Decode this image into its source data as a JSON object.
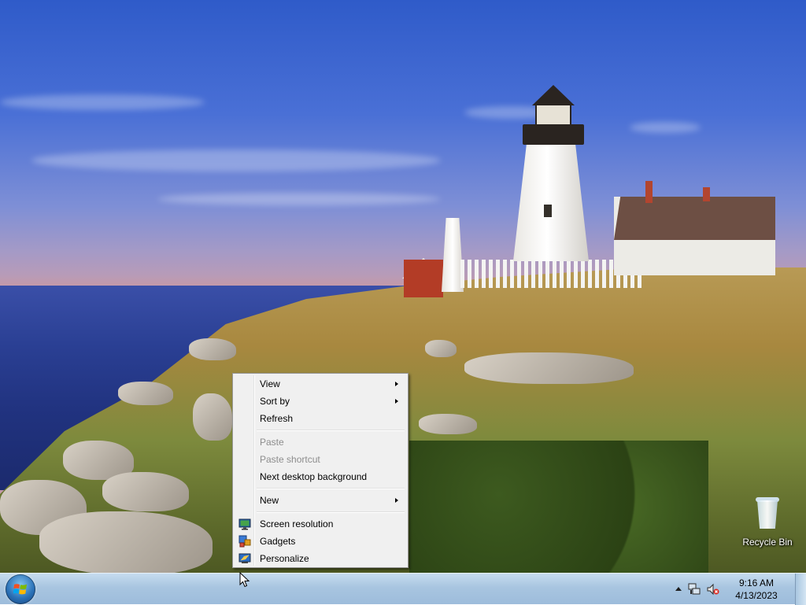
{
  "desktop": {
    "icons": [
      {
        "label": "Recycle Bin",
        "icon": "recycle-bin-icon"
      }
    ]
  },
  "context_menu": {
    "groups": [
      [
        {
          "label": "View",
          "submenu": true,
          "enabled": true
        },
        {
          "label": "Sort by",
          "submenu": true,
          "enabled": true
        },
        {
          "label": "Refresh",
          "submenu": false,
          "enabled": true
        }
      ],
      [
        {
          "label": "Paste",
          "submenu": false,
          "enabled": false
        },
        {
          "label": "Paste shortcut",
          "submenu": false,
          "enabled": false
        },
        {
          "label": "Next desktop background",
          "submenu": false,
          "enabled": true
        }
      ],
      [
        {
          "label": "New",
          "submenu": true,
          "enabled": true
        }
      ],
      [
        {
          "label": "Screen resolution",
          "icon": "screen-resolution-icon",
          "enabled": true
        },
        {
          "label": "Gadgets",
          "icon": "gadgets-icon",
          "enabled": true
        },
        {
          "label": "Personalize",
          "icon": "personalize-icon",
          "enabled": true
        }
      ]
    ]
  },
  "taskbar": {
    "start_icon": "windows-start-orb-icon",
    "tray": {
      "icons": [
        "show-hidden-icons-chevron-icon",
        "network-icon",
        "volume-muted-icon"
      ],
      "clock": {
        "time": "9:16 AM",
        "date": "4/13/2023"
      }
    }
  },
  "colors": {
    "taskbar": "#a8c5e0",
    "menu_bg": "#f0f0f0",
    "menu_disabled_text": "#8d8d8d"
  }
}
